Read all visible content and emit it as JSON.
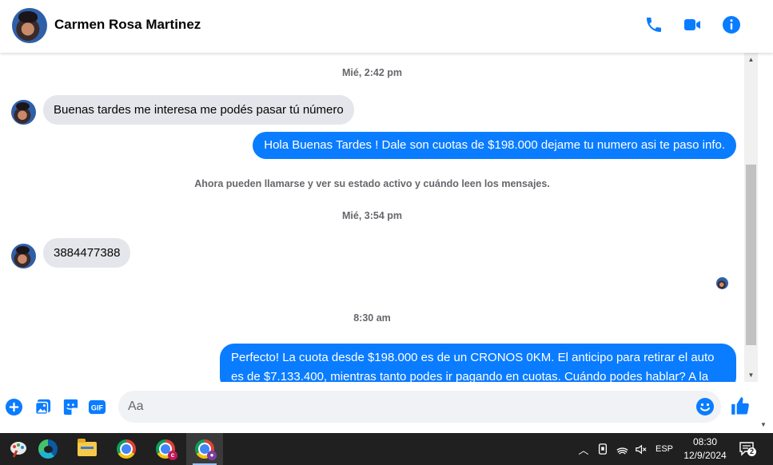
{
  "header": {
    "contact_name": "Carmen Rosa Martinez",
    "icons": [
      "phone-icon",
      "video-call-icon",
      "info-icon"
    ]
  },
  "chat": {
    "messages": [
      {
        "type": "timestamp",
        "text": "Mié, 2:42 pm"
      },
      {
        "type": "incoming",
        "text": "Buenas tardes me interesa me podés pasar tú número"
      },
      {
        "type": "outgoing",
        "text": "Hola Buenas Tardes ! Dale son cuotas de $198.000 dejame tu numero asi te paso info."
      },
      {
        "type": "system",
        "text": "Ahora pueden llamarse y ver su estado activo y cuándo leen los mensajes."
      },
      {
        "type": "timestamp",
        "text": "Mié, 3:54 pm"
      },
      {
        "type": "incoming",
        "text": "3884477388"
      },
      {
        "type": "timestamp",
        "text": "8:30 am"
      },
      {
        "type": "outgoing",
        "text": "Perfecto! La cuota desde $198.000 es de un CRONOS 0KM. El anticipo para retirar el auto es de $7.133.400, mientras tanto podes ir pagando en cuotas. Cuándo podes hablar? A la"
      }
    ]
  },
  "composer": {
    "placeholder": "Aa",
    "icons": [
      "add-icon",
      "photo-icon",
      "sticker-icon",
      "gif-icon",
      "emoji-icon",
      "like-icon"
    ],
    "gif_label": "GIF"
  },
  "taskbar": {
    "apps": [
      "paint-app",
      "edge-app",
      "file-explorer-app",
      "chrome-app",
      "chrome-profile-c-app",
      "chrome-profile-active-app"
    ],
    "tray": {
      "language": "ESP",
      "time": "08:30",
      "date": "12/9/2024",
      "notifications": "2"
    }
  },
  "colors": {
    "accent": "#0a7cff",
    "incoming_bubble": "#e4e6eb",
    "taskbar": "#202020"
  }
}
